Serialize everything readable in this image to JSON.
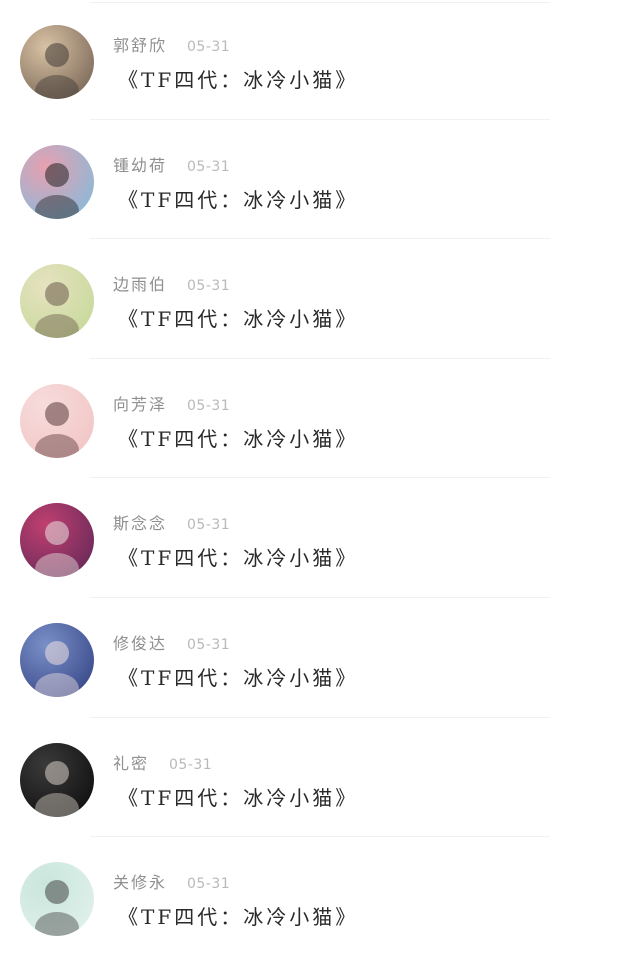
{
  "comments": [
    {
      "name": "郭舒欣",
      "date": "05-31",
      "text": "《TF四代：冰冷小猫》",
      "avatar": "photo-girl-avatar",
      "colors": [
        "#7d6a5a",
        "#d9c2a4",
        "#3f3a36"
      ]
    },
    {
      "name": "锺幼荷",
      "date": "05-31",
      "text": "《TF四代：冰冷小猫》",
      "avatar": "drawn-finger-avatar",
      "colors": [
        "#8ab9d8",
        "#e8a0b0",
        "#222222"
      ]
    },
    {
      "name": "边雨伯",
      "date": "05-31",
      "text": "《TF四代：冰冷小猫》",
      "avatar": "outdoor-girl-avatar",
      "colors": [
        "#c8d99c",
        "#e6e2c0",
        "#6b5a4a"
      ]
    },
    {
      "name": "向芳泽",
      "date": "05-31",
      "text": "《TF四代：冰冷小猫》",
      "avatar": "pink-blob-avatar",
      "colors": [
        "#f2c6c6",
        "#f7dcdc",
        "#5a3a3a"
      ]
    },
    {
      "name": "斯念念",
      "date": "05-31",
      "text": "《TF四代：冰冷小猫》",
      "avatar": "purple-flower-avatar",
      "colors": [
        "#6a2a5a",
        "#c04070",
        "#e8e4e0"
      ]
    },
    {
      "name": "修俊达",
      "date": "05-31",
      "text": "《TF四代：冰冷小猫》",
      "avatar": "anime-boy-avatar",
      "colors": [
        "#3a4a8a",
        "#7a90c8",
        "#f0e0e0"
      ]
    },
    {
      "name": "礼密",
      "date": "05-31",
      "text": "《TF四代：冰冷小猫》",
      "avatar": "dark-portrait-avatar",
      "colors": [
        "#111111",
        "#3a3a3a",
        "#d8d0c8"
      ]
    },
    {
      "name": "关修永",
      "date": "05-31",
      "text": "《TF四代：冰冷小猫》",
      "avatar": "couple-cartoon-avatar",
      "colors": [
        "#dff0ea",
        "#c9e6dc",
        "#444444"
      ]
    }
  ]
}
